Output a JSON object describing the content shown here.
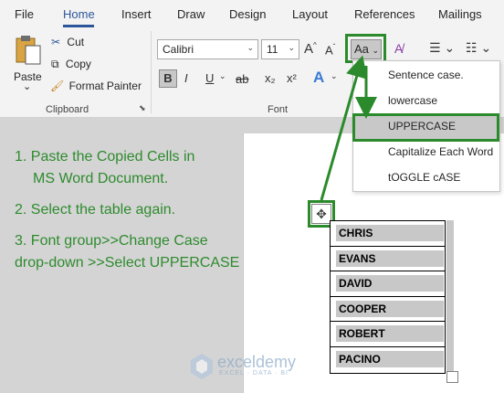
{
  "tabs": {
    "file": "File",
    "home": "Home",
    "insert": "Insert",
    "draw": "Draw",
    "design": "Design",
    "layout": "Layout",
    "references": "References",
    "mailings": "Mailings"
  },
  "clipboard": {
    "paste": "Paste",
    "paste_arrow": "⌄",
    "cut": "Cut",
    "copy": "Copy",
    "format_painter": "Format Painter",
    "label": "Clipboard",
    "launcher": "⬊"
  },
  "font": {
    "family": "Calibri",
    "size": "11",
    "label": "Font",
    "grow": "A",
    "shrink": "A",
    "change_case": "Aa",
    "bold": "B",
    "italic": "I",
    "underline": "U",
    "strike": "ab",
    "subscript": "x₂",
    "superscript": "x²",
    "text_effects": "A"
  },
  "change_case_menu": {
    "sentence": "Sentence case.",
    "lower": "lowercase",
    "upper": "UPPERCASE",
    "capitalize": "Capitalize Each Word",
    "toggle": "tOGGLE cASE"
  },
  "instructions": {
    "step1_line1": "1. Paste the Copied Cells in",
    "step1_line2": "MS Word Document.",
    "step2": "2. Select the table again.",
    "step3_line1": "3. Font group>>Change Case",
    "step3_line2": "drop-down >>Select UPPERCASE"
  },
  "table": {
    "rows": [
      "CHRIS",
      "EVANS",
      "DAVID",
      "COOPER",
      "ROBERT",
      "PACINO"
    ]
  },
  "watermark": {
    "name": "exceldemy",
    "tagline": "EXCEL · DATA · BI"
  },
  "colors": {
    "accent_tab": "#2b579a",
    "highlight_green": "#2b8a2b",
    "instruction_text": "#2e8b2e",
    "selection_gray": "#c8c8c8"
  }
}
